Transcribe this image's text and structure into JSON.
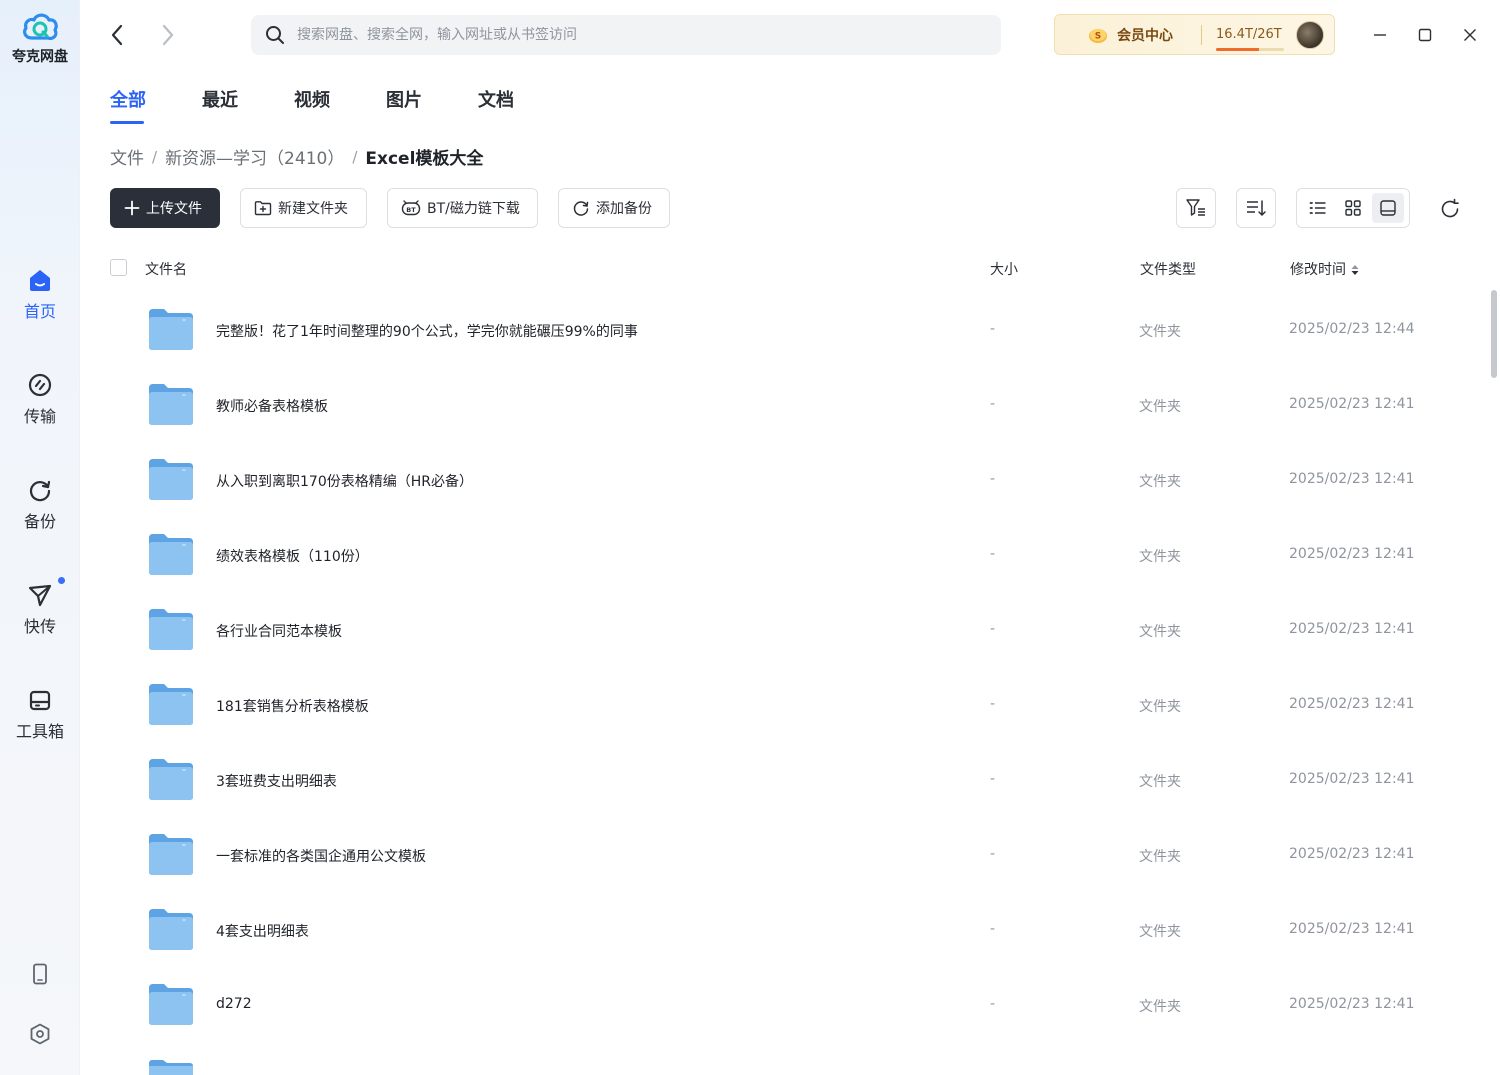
{
  "app": {
    "name": "夸克网盘"
  },
  "sidebar": {
    "items": [
      {
        "label": "首页",
        "icon": "home-icon",
        "active": true
      },
      {
        "label": "传输",
        "icon": "transfer-icon",
        "active": false
      },
      {
        "label": "备份",
        "icon": "backup-icon",
        "active": false
      },
      {
        "label": "快传",
        "icon": "quick-send-icon",
        "active": false,
        "badge": true
      },
      {
        "label": "工具箱",
        "icon": "toolbox-icon",
        "active": false
      }
    ],
    "bottom_icons": [
      "phone-icon",
      "settings-icon"
    ]
  },
  "search": {
    "placeholder": "搜索网盘、搜索全网，输入网址或从书签访问"
  },
  "vip": {
    "label": "会员中心",
    "storage": "16.4T/26T",
    "storage_used_fraction": 0.63
  },
  "tabs": [
    {
      "label": "全部",
      "active": true
    },
    {
      "label": "最近",
      "active": false
    },
    {
      "label": "视频",
      "active": false
    },
    {
      "label": "图片",
      "active": false
    },
    {
      "label": "文档",
      "active": false
    }
  ],
  "breadcrumb": [
    "文件",
    "新资源—学习（2410）",
    "Excel模板大全"
  ],
  "toolbar": {
    "upload": "上传文件",
    "new_folder": "新建文件夹",
    "bt_download": "BT/磁力链下载",
    "add_backup": "添加备份"
  },
  "table": {
    "columns": {
      "name": "文件名",
      "size": "大小",
      "type": "文件类型",
      "modified": "修改时间"
    },
    "rows": [
      {
        "name": "完整版！花了1年时间整理的90个公式，学完你就能碾压99%的同事",
        "size": "-",
        "type": "文件夹",
        "modified": "2025/02/23 12:44"
      },
      {
        "name": "教师必备表格模板",
        "size": "-",
        "type": "文件夹",
        "modified": "2025/02/23 12:41"
      },
      {
        "name": "从入职到离职170份表格精编（HR必备）",
        "size": "-",
        "type": "文件夹",
        "modified": "2025/02/23 12:41"
      },
      {
        "name": "绩效表格模板（110份）",
        "size": "-",
        "type": "文件夹",
        "modified": "2025/02/23 12:41"
      },
      {
        "name": "各行业合同范本模板",
        "size": "-",
        "type": "文件夹",
        "modified": "2025/02/23 12:41"
      },
      {
        "name": "181套销售分析表格模板",
        "size": "-",
        "type": "文件夹",
        "modified": "2025/02/23 12:41"
      },
      {
        "name": "3套班费支出明细表",
        "size": "-",
        "type": "文件夹",
        "modified": "2025/02/23 12:41"
      },
      {
        "name": "一套标准的各类国企通用公文模板",
        "size": "-",
        "type": "文件夹",
        "modified": "2025/02/23 12:41"
      },
      {
        "name": "4套支出明细表",
        "size": "-",
        "type": "文件夹",
        "modified": "2025/02/23 12:41"
      },
      {
        "name": "d272",
        "size": "-",
        "type": "文件夹",
        "modified": "2025/02/23 12:41"
      }
    ]
  },
  "colors": {
    "accent": "#2b63f6",
    "primary_button": "#2a2f3a",
    "folder": "#7fb8ec"
  }
}
